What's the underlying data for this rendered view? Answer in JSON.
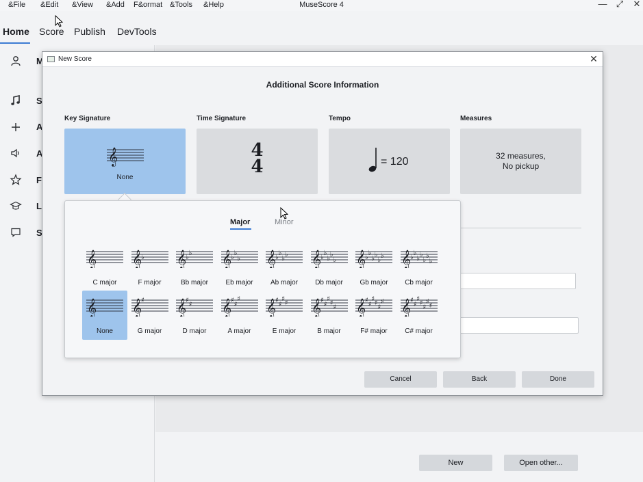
{
  "menubar": {
    "items": [
      "&File",
      "&Edit",
      "&View",
      "&Add",
      "F&ormat",
      "&Tools",
      "&Help"
    ],
    "title": "MuseScore 4",
    "window_controls": [
      "minimize-icon",
      "maximize-icon",
      "close-icon"
    ]
  },
  "main_tabs": [
    {
      "label": "Home",
      "active": true
    },
    {
      "label": "Score",
      "active": false
    },
    {
      "label": "Publish",
      "active": false
    },
    {
      "label": "DevTools",
      "active": false
    }
  ],
  "sidebar": {
    "items": [
      {
        "icon": "account-icon",
        "label": "M"
      },
      {
        "icon": "music-note-icon",
        "label": "S"
      },
      {
        "icon": "plus-icon",
        "label": "A"
      },
      {
        "icon": "audio-icon",
        "label": "A"
      },
      {
        "icon": "star-icon",
        "label": "F"
      },
      {
        "icon": "graduation-cap-icon",
        "label": "L"
      },
      {
        "icon": "chat-icon",
        "label": "S"
      }
    ]
  },
  "home_buttons": {
    "new": "New",
    "open_other": "Open other..."
  },
  "dialog": {
    "title": "New Score",
    "heading": "Additional Score Information",
    "cards": {
      "key_signature": {
        "label": "Key Signature",
        "value": "None"
      },
      "time_signature": {
        "label": "Time Signature",
        "numerator": "4",
        "denominator": "4"
      },
      "tempo": {
        "label": "Tempo",
        "value": "= 120"
      },
      "measures": {
        "label": "Measures",
        "line1": "32 measures,",
        "line2": "No pickup"
      }
    },
    "buttons": {
      "cancel": "Cancel",
      "back": "Back",
      "done": "Done"
    }
  },
  "key_popup": {
    "tabs": {
      "major": "Major",
      "minor": "Minor",
      "active": "Major"
    },
    "flat_row": [
      {
        "label": "C major",
        "accidental": "flat",
        "count": 0
      },
      {
        "label": "F major",
        "accidental": "flat",
        "count": 1
      },
      {
        "label": "Bb major",
        "accidental": "flat",
        "count": 2
      },
      {
        "label": "Eb major",
        "accidental": "flat",
        "count": 3
      },
      {
        "label": "Ab major",
        "accidental": "flat",
        "count": 4
      },
      {
        "label": "Db major",
        "accidental": "flat",
        "count": 5
      },
      {
        "label": "Gb major",
        "accidental": "flat",
        "count": 6
      },
      {
        "label": "Cb major",
        "accidental": "flat",
        "count": 7
      }
    ],
    "sharp_row": [
      {
        "label": "None",
        "accidental": "none",
        "count": 0,
        "selected": true
      },
      {
        "label": "G major",
        "accidental": "sharp",
        "count": 1
      },
      {
        "label": "D major",
        "accidental": "sharp",
        "count": 2
      },
      {
        "label": "A major",
        "accidental": "sharp",
        "count": 3
      },
      {
        "label": "E major",
        "accidental": "sharp",
        "count": 4
      },
      {
        "label": "B major",
        "accidental": "sharp",
        "count": 5
      },
      {
        "label": "F# major",
        "accidental": "sharp",
        "count": 6
      },
      {
        "label": "C# major",
        "accidental": "sharp",
        "count": 7
      }
    ]
  },
  "colors": {
    "accent": "#3b7bd3",
    "selected": "#9ec4ec",
    "card": "#dadcdf",
    "button": "#d5d8dc"
  }
}
